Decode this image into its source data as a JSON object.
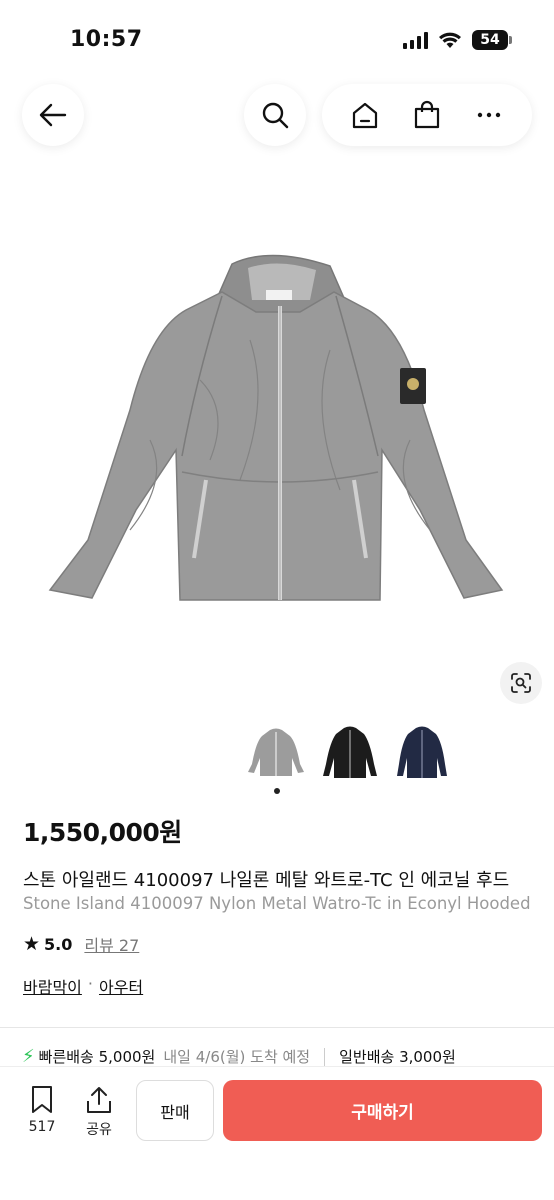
{
  "status": {
    "time": "10:57",
    "battery": "54"
  },
  "nav": {
    "back_icon": "arrow-left-icon",
    "search_icon": "search-icon",
    "home_icon": "home-icon",
    "bag_icon": "shopping-bag-icon",
    "more_icon": "more-horizontal-icon"
  },
  "product": {
    "price": "1,550,000원",
    "title_ko": "스톤 아일랜드 4100097 나일론 메탈 와트로-TC 인 에코닐 후드",
    "title_en": "Stone Island 4100097 Nylon Metal Watro-Tc in Econyl Hooded",
    "rating": "5.0",
    "reviews": "리뷰 27",
    "category_1": "바람막이",
    "category_sep": "·",
    "category_2": "아우터",
    "thumbnails": [
      "grey-jacket-thumbnail",
      "black-jacket-thumbnail",
      "navy-jacket-thumbnail"
    ],
    "selected_thumbnail_index": 0
  },
  "shipping": {
    "fast_label": "빠른배송 5,000원",
    "fast_eta": "내일 4/6(월) 도착 예정",
    "normal_label": "일반배송 3,000원"
  },
  "bottom": {
    "bookmark_count": "517",
    "share_label": "공유",
    "sell_label": "판매",
    "buy_label": "구매하기"
  },
  "colors": {
    "buy_button": "#f05d54",
    "fast_bolt": "#2fc55a"
  }
}
